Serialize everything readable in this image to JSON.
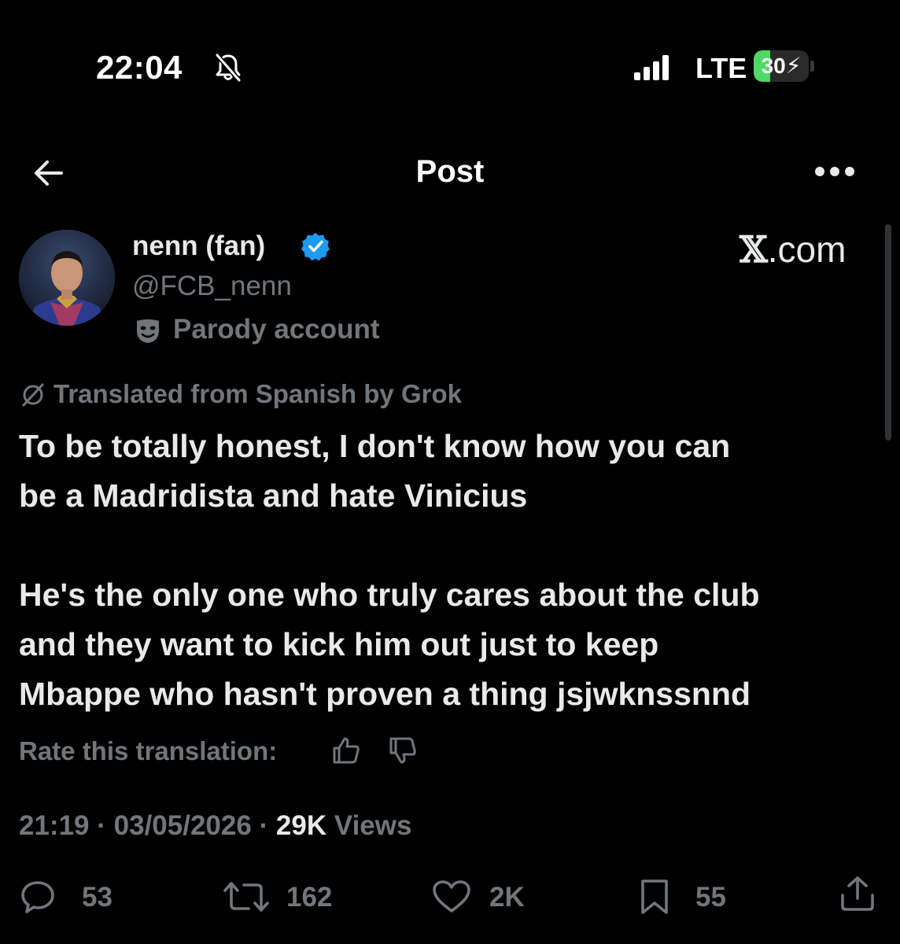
{
  "status_bar": {
    "time": "22:04",
    "network": "LTE",
    "battery_level": "30",
    "battery_fraction": 0.3,
    "icons": [
      "bell-slash-icon",
      "signal-bars-icon",
      "battery-charging-icon"
    ],
    "battery_color": "#4cd964"
  },
  "header": {
    "title": "Post",
    "icons": [
      "arrow-left-icon",
      "more-horizontal-icon"
    ]
  },
  "author": {
    "display_name": "nenn (fan)",
    "handle": "@FCB_nenn",
    "badge": "Parody account",
    "verified": true,
    "verified_color": "#1d9bf0"
  },
  "watermark": {
    "brand_x": "𝕏",
    "brand_domain": ".com"
  },
  "translation": {
    "note": "Translated from Spanish by Grok",
    "rate_label": "Rate this translation:"
  },
  "tweet": {
    "paragraph_1_line_1": "To be totally honest, I don't know how you can",
    "paragraph_1_line_2": "be a Madridista and hate Vinicius",
    "paragraph_2_line_1": "He's the only one who truly cares about the club",
    "paragraph_2_line_2": "and they want to kick him out just to keep",
    "paragraph_2_line_3": "Mbappe who hasn't proven a thing jsjwknssnnd"
  },
  "meta": {
    "time": "21:19",
    "separator": " · ",
    "date": "03/05/2026",
    "views_count": "29K",
    "views_label": " Views"
  },
  "actions": {
    "replies": "53",
    "reposts": "162",
    "likes": "2K",
    "bookmarks": "55"
  },
  "colors": {
    "background": "#000000",
    "text_primary": "#e7e9ea",
    "text_secondary": "#71767b"
  }
}
